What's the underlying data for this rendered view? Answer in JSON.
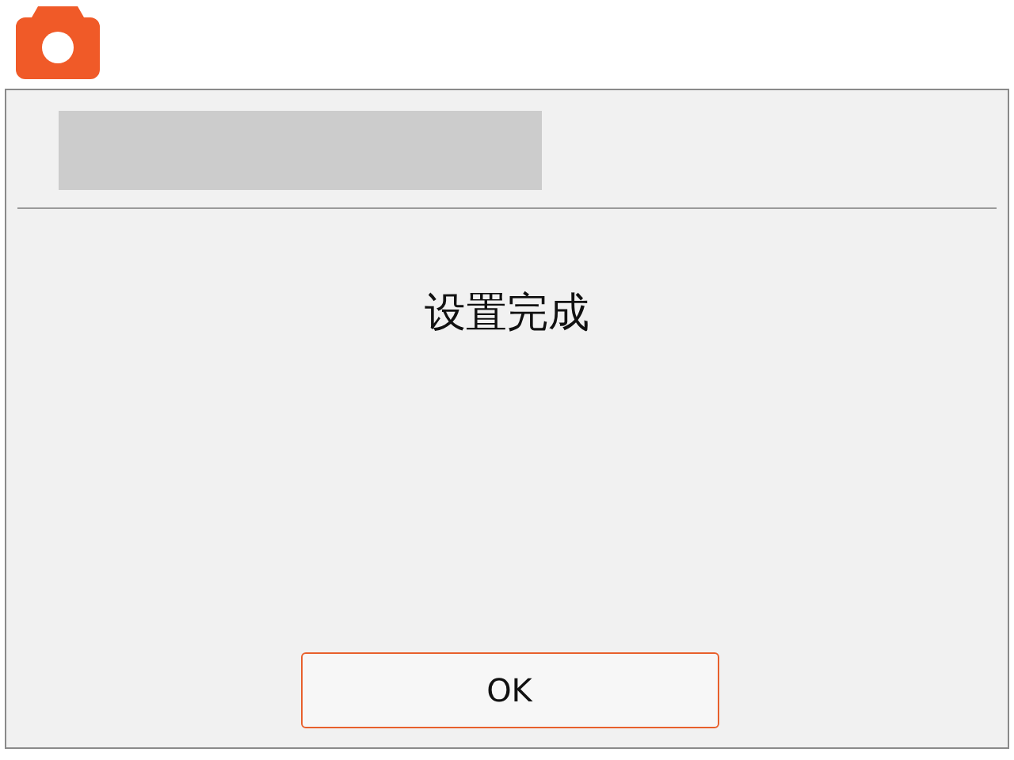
{
  "dialog": {
    "message": "设置完成",
    "button": "OK"
  }
}
